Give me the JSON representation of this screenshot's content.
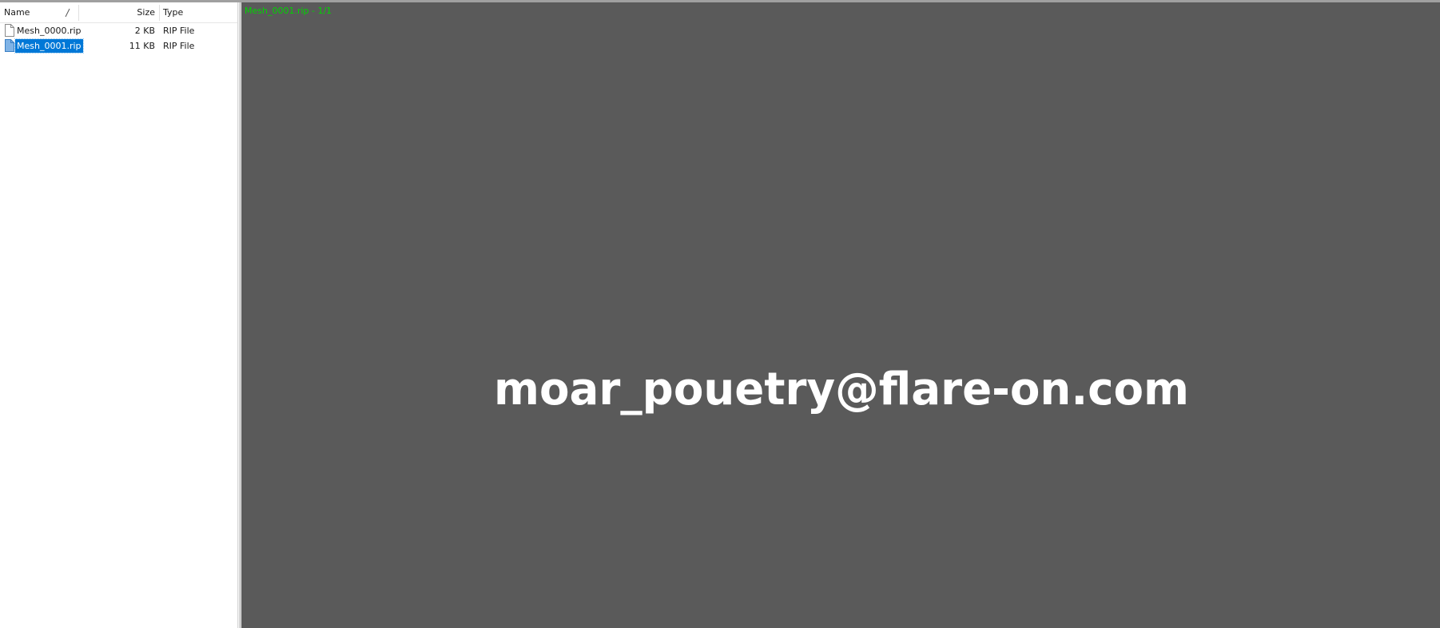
{
  "file_list": {
    "columns": {
      "name": "Name",
      "size": "Size",
      "type": "Type"
    },
    "files": [
      {
        "name": "Mesh_0000.rip",
        "size": "2 KB",
        "type": "RIP File",
        "selected": false
      },
      {
        "name": "Mesh_0001.rip",
        "size": "11 KB",
        "type": "RIP File",
        "selected": true
      }
    ]
  },
  "viewport": {
    "status": "Mesh_0001.rip - 1/1",
    "mesh_text": "moar_pouetry@flare-on.com",
    "status_color": "#00d400",
    "background_color": "#5a5a5a",
    "mesh_color": "#ffffff"
  },
  "selection_color": "#0078d7"
}
